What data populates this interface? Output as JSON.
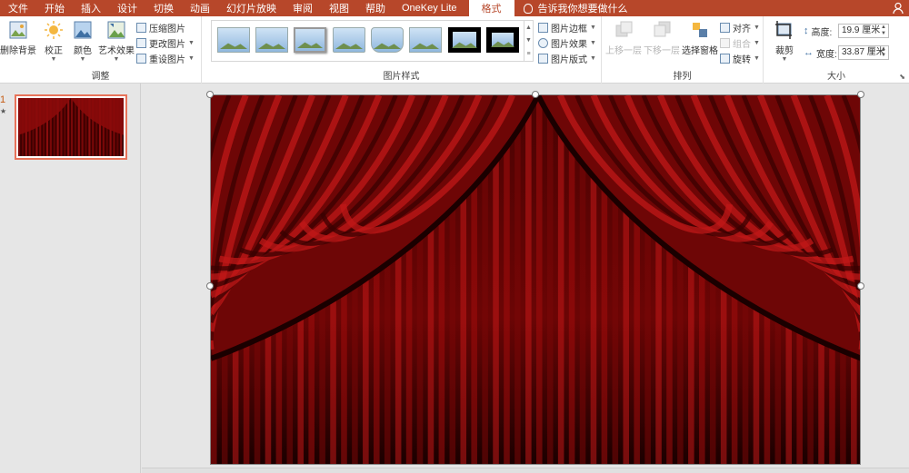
{
  "tabs": [
    "文件",
    "开始",
    "插入",
    "设计",
    "切换",
    "动画",
    "幻灯片放映",
    "审阅",
    "视图",
    "帮助",
    "OneKey Lite",
    "格式"
  ],
  "active_tab": "格式",
  "tell_me": "告诉我你想要做什么",
  "adjust": {
    "remove_bg": "删除背景",
    "corrections": "校正",
    "color": "颜色",
    "artistic": "艺术效果",
    "compress": "压缩图片",
    "change": "更改图片",
    "reset": "重设图片",
    "label": "调整"
  },
  "styles": {
    "label": "图片样式",
    "border": "图片边框",
    "effects": "图片效果",
    "layout": "图片版式"
  },
  "arrange": {
    "label": "排列",
    "forward": "上移一层",
    "backward": "下移一层",
    "selection_pane": "选择窗格",
    "align": "对齐",
    "group": "组合",
    "rotate": "旋转"
  },
  "size": {
    "label": "大小",
    "crop": "裁剪",
    "height_label": "高度:",
    "height_value": "19.9 厘米",
    "width_label": "宽度:",
    "width_value": "33.87 厘米"
  },
  "slides": {
    "number": "1",
    "star": "★"
  },
  "colors": {
    "accent": "#b7472a",
    "curtain": "#8b0a0a",
    "thumb_border": "#e8735a"
  }
}
